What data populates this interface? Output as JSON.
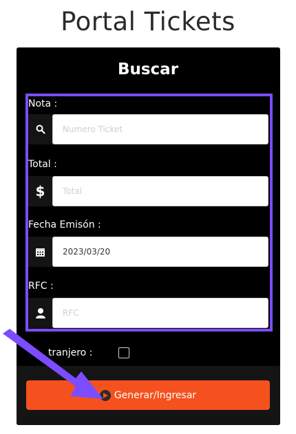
{
  "page": {
    "title": "Portal Tickets"
  },
  "panel": {
    "heading": "Buscar"
  },
  "fields": {
    "nota": {
      "label": "Nota :",
      "placeholder": "Numero Ticket",
      "icon": "search-icon"
    },
    "total": {
      "label": "Total :",
      "placeholder": "Total",
      "icon": "dollar-icon"
    },
    "fecha": {
      "label": "Fecha Emisón :",
      "value": "2023/03/20",
      "icon": "calendar-icon"
    },
    "rfc": {
      "label": "RFC :",
      "placeholder": "RFC",
      "icon": "user-icon"
    }
  },
  "extranjero": {
    "label": "Extranjero :",
    "visible_label": "tranjero :"
  },
  "submit": {
    "label": "Generar/Ingresar",
    "color": "#f4511e"
  },
  "colors": {
    "highlight": "#7b4dff",
    "panel_bg": "#000000",
    "footer_bg": "#141414"
  }
}
